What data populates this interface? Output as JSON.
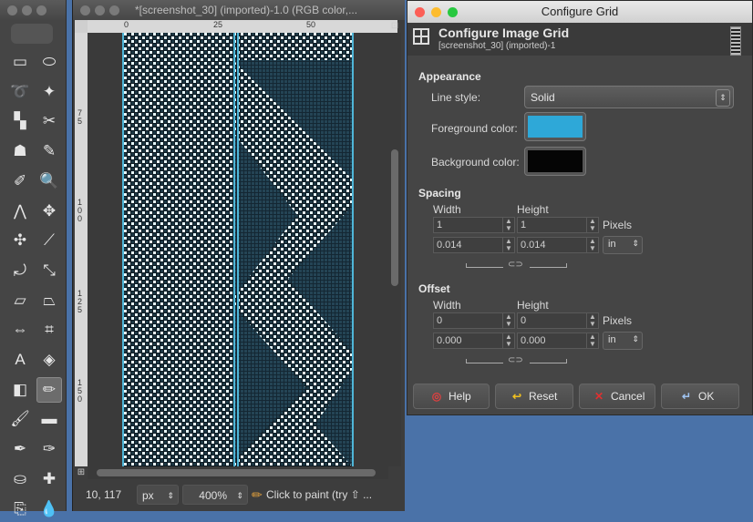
{
  "toolbox": {
    "tools": [
      {
        "name": "rect-select-icon",
        "glyph": "▭"
      },
      {
        "name": "ellipse-select-icon",
        "glyph": "⬭"
      },
      {
        "name": "lasso-icon",
        "glyph": "➰"
      },
      {
        "name": "fuzzy-select-icon",
        "glyph": "✦"
      },
      {
        "name": "select-by-color-icon",
        "glyph": "▚"
      },
      {
        "name": "scissors-icon",
        "glyph": "✂"
      },
      {
        "name": "foreground-select-icon",
        "glyph": "☗"
      },
      {
        "name": "paths-icon",
        "glyph": "✎"
      },
      {
        "name": "color-picker-icon",
        "glyph": "✐"
      },
      {
        "name": "zoom-icon",
        "glyph": "🔍"
      },
      {
        "name": "measure-icon",
        "glyph": "⋀"
      },
      {
        "name": "move-icon",
        "glyph": "✥"
      },
      {
        "name": "align-icon",
        "glyph": "✣"
      },
      {
        "name": "crop-icon",
        "glyph": "⟋"
      },
      {
        "name": "rotate-icon",
        "glyph": "⤾"
      },
      {
        "name": "scale-icon",
        "glyph": "⤡"
      },
      {
        "name": "shear-icon",
        "glyph": "▱"
      },
      {
        "name": "perspective-icon",
        "glyph": "⏢"
      },
      {
        "name": "flip-icon",
        "glyph": "⇔"
      },
      {
        "name": "cage-icon",
        "glyph": "⌗"
      },
      {
        "name": "text-icon",
        "glyph": "A"
      },
      {
        "name": "bucket-fill-icon",
        "glyph": "◈"
      },
      {
        "name": "blend-icon",
        "glyph": "◧"
      },
      {
        "name": "pencil-icon",
        "glyph": "✏"
      },
      {
        "name": "paintbrush-icon",
        "glyph": "🖌"
      },
      {
        "name": "eraser-icon",
        "glyph": "▬"
      },
      {
        "name": "airbrush-icon",
        "glyph": "✒"
      },
      {
        "name": "ink-icon",
        "glyph": "✑"
      },
      {
        "name": "clone-icon",
        "glyph": "⛀"
      },
      {
        "name": "heal-icon",
        "glyph": "✚"
      },
      {
        "name": "perspective-clone-icon",
        "glyph": "⎘"
      },
      {
        "name": "smudge-icon",
        "glyph": "💧"
      }
    ]
  },
  "image_window": {
    "title": "*[screenshot_30] (imported)-1.0 (RGB color,...",
    "ruler_h_ticks": [
      "0",
      "25",
      "50"
    ],
    "ruler_v_ticks": [
      "7\n5",
      "1\n0\n0",
      "1\n2\n5",
      "1\n5\n0"
    ],
    "coords": "10, 117",
    "unit": "px",
    "zoom": "400%",
    "status": "Click to paint (try ⇧ ..."
  },
  "dialog": {
    "window_title": "Configure Grid",
    "header_title": "Configure Image Grid",
    "header_subtitle": "[screenshot_30] (imported)-1",
    "appearance": {
      "section": "Appearance",
      "line_style_label": "Line style:",
      "line_style_value": "Solid",
      "fg_label": "Foreground color:",
      "bg_label": "Background color:",
      "fg_color": "#2ea8d8",
      "bg_color": "#050505"
    },
    "spacing": {
      "section": "Spacing",
      "width_label": "Width",
      "height_label": "Height",
      "width_px": "1",
      "height_px": "1",
      "unit_px": "Pixels",
      "width_in": "0.014",
      "height_in": "0.014",
      "unit_in": "in"
    },
    "offset": {
      "section": "Offset",
      "width_label": "Width",
      "height_label": "Height",
      "width_px": "0",
      "height_px": "0",
      "unit_px": "Pixels",
      "width_in": "0.000",
      "height_in": "0.000",
      "unit_in": "in"
    },
    "buttons": {
      "help": "Help",
      "reset": "Reset",
      "cancel": "Cancel",
      "ok": "OK"
    }
  }
}
